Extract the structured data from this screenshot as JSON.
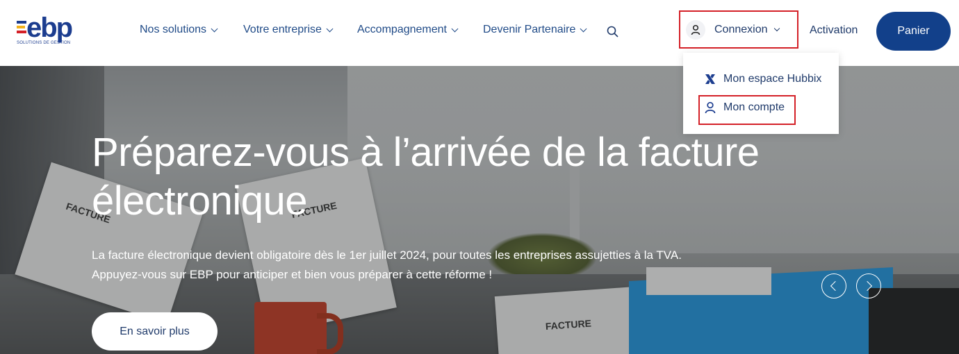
{
  "logo": {
    "text": "ebp",
    "subtitle": "SOLUTIONS DE GESTION",
    "bar_colors": [
      "#1c3d8f",
      "#f2b21c",
      "#d42027"
    ]
  },
  "nav": {
    "items": [
      {
        "label": "Nos solutions"
      },
      {
        "label": "Votre entreprise"
      },
      {
        "label": "Accompagnement"
      },
      {
        "label": "Devenir Partenaire"
      }
    ]
  },
  "header": {
    "connexion_label": "Connexion",
    "activation_label": "Activation",
    "panier_label": "Panier"
  },
  "dropdown": {
    "items": [
      {
        "label": "Mon espace Hubbix",
        "icon": "hubbix-icon"
      },
      {
        "label": "Mon compte",
        "icon": "user-icon"
      }
    ]
  },
  "hero": {
    "title": "Préparez-vous à l’arrivée de la facture électronique",
    "text_line1": "La facture électronique devient obligatoire dès le 1er juillet 2024, pour toutes les entreprises assujetties à la TVA.",
    "text_line2": "Appuyez-vous sur EBP pour anticiper et bien vous préparer à cette réforme !",
    "cta_label": "En savoir plus",
    "image_texts": {
      "paper1": "FACTURE",
      "paper2": "FACTURE",
      "paper3": "FACTURE"
    }
  },
  "colors": {
    "brand_blue": "#12408a",
    "highlight_red": "#d42027",
    "nav_text": "#1f4a87"
  }
}
